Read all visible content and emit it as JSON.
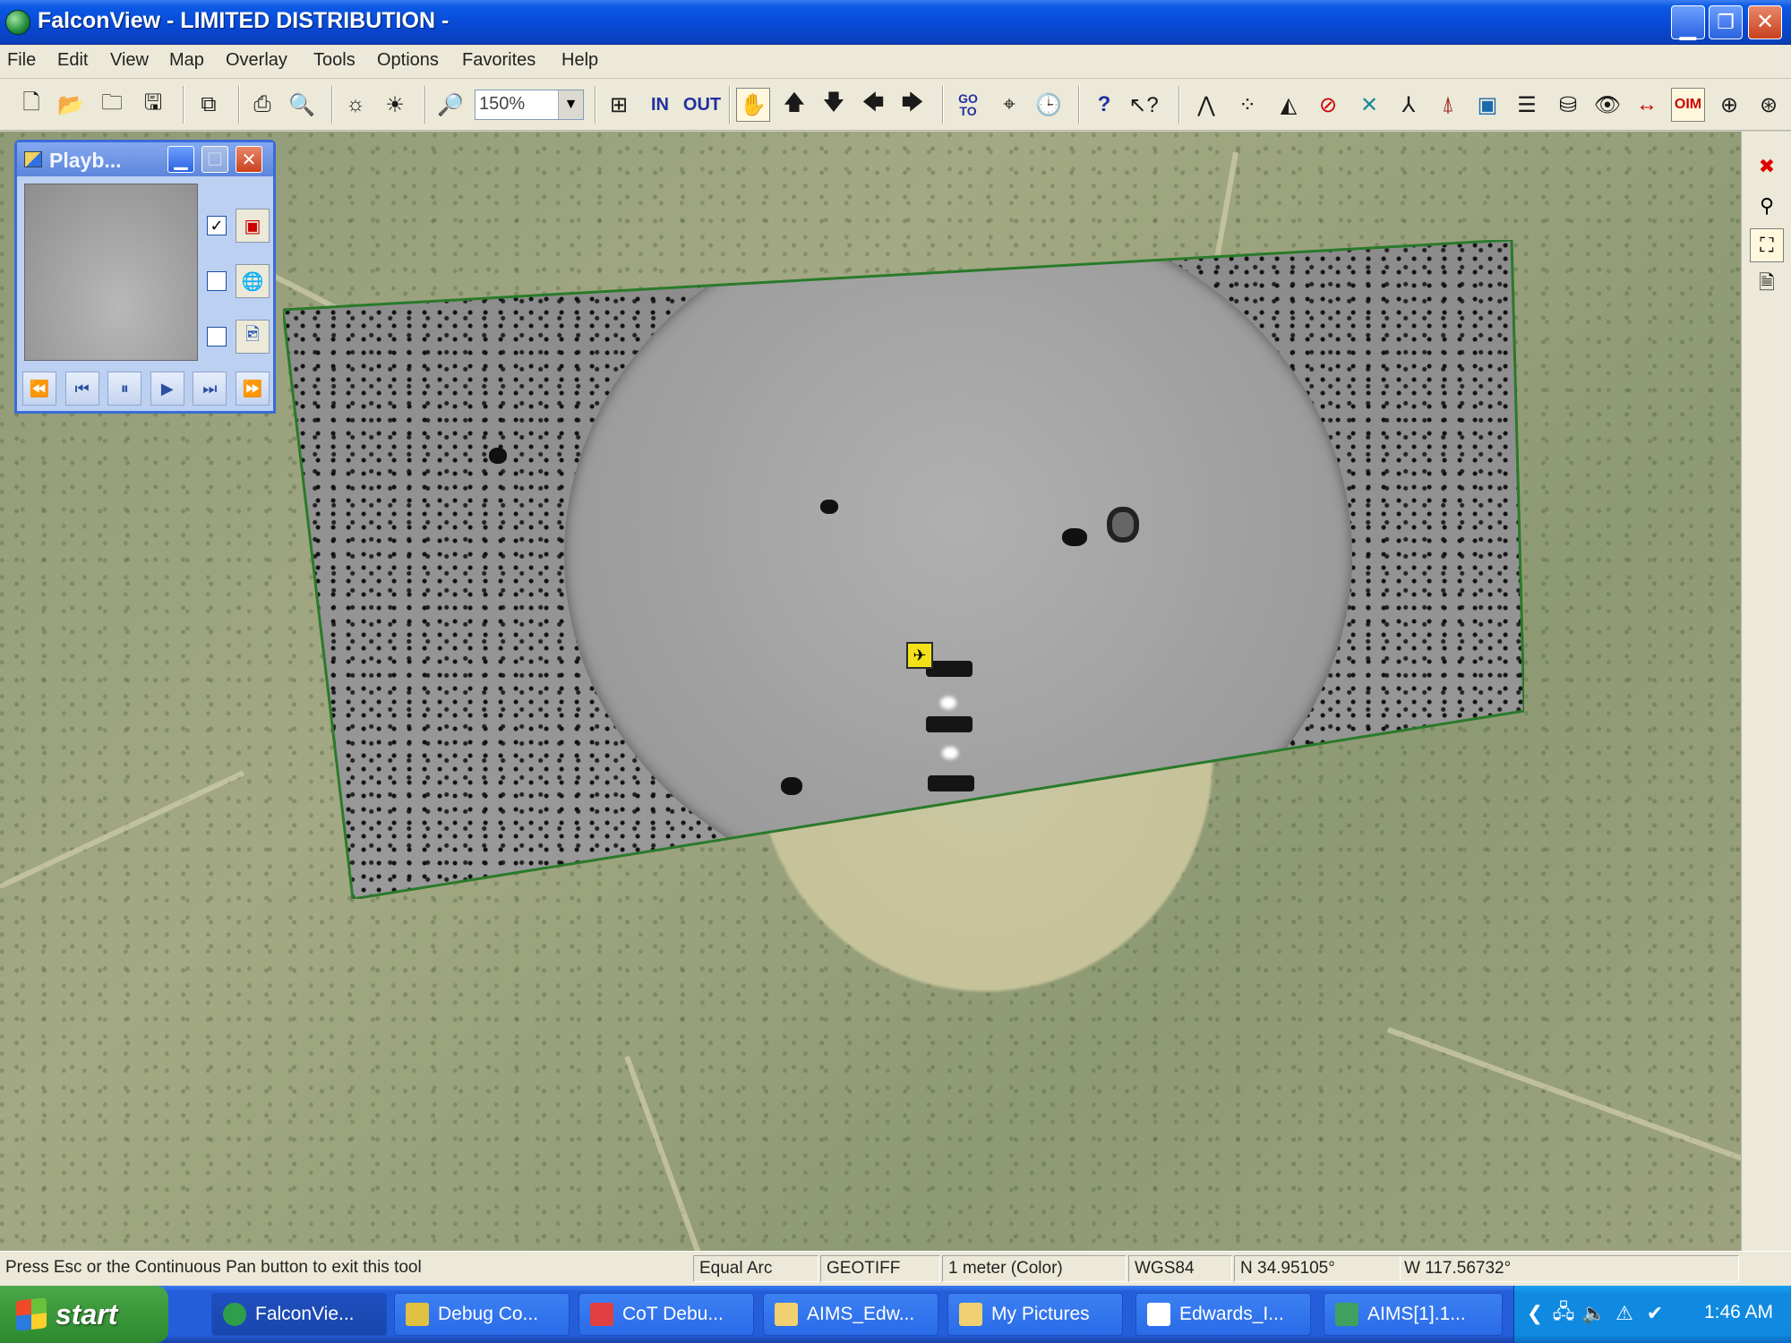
{
  "window": {
    "title": "FalconView - LIMITED DISTRIBUTION -"
  },
  "menu": {
    "items": [
      "File",
      "Edit",
      "View",
      "Map",
      "Overlay",
      "Tools",
      "Options",
      "Favorites",
      "Help"
    ]
  },
  "toolbar": {
    "zoom_value": "150%",
    "zoom_in_label": "IN",
    "zoom_out_label": "OUT",
    "goto_label": "GO TO"
  },
  "playback": {
    "title": "Playb...",
    "layers": [
      {
        "checked": true,
        "icon": "frame-icon"
      },
      {
        "checked": false,
        "icon": "globe-icon"
      },
      {
        "checked": false,
        "icon": "image-icon"
      }
    ],
    "controls": [
      "rewind-icon",
      "step-back-icon",
      "pause-icon",
      "play-icon",
      "step-forward-icon",
      "fast-forward-icon"
    ]
  },
  "map": {
    "marker_icon": "aircraft-icon"
  },
  "status": {
    "message": "Press Esc or the Continuous Pan button to exit this tool",
    "projection": "Equal Arc",
    "map_type": "GEOTIFF",
    "scale": "1 meter (Color)",
    "datum": "WGS84",
    "latitude": "N  34.95105°",
    "longitude": "W  117.56732°"
  },
  "taskbar": {
    "start_label": "start",
    "tasks": [
      {
        "label": "FalconVie...",
        "color": "#2e9e4a"
      },
      {
        "label": "Debug Co...",
        "color": "#e0c040"
      },
      {
        "label": "CoT Debu...",
        "color": "#e04040"
      },
      {
        "label": "AIMS_Edw...",
        "color": "#f0d070"
      },
      {
        "label": "My Pictures",
        "color": "#f0d070"
      },
      {
        "label": "Edwards_I...",
        "color": "#ffffff"
      },
      {
        "label": "AIMS[1].1...",
        "color": "#40a060"
      }
    ],
    "clock": "1:46 AM"
  }
}
